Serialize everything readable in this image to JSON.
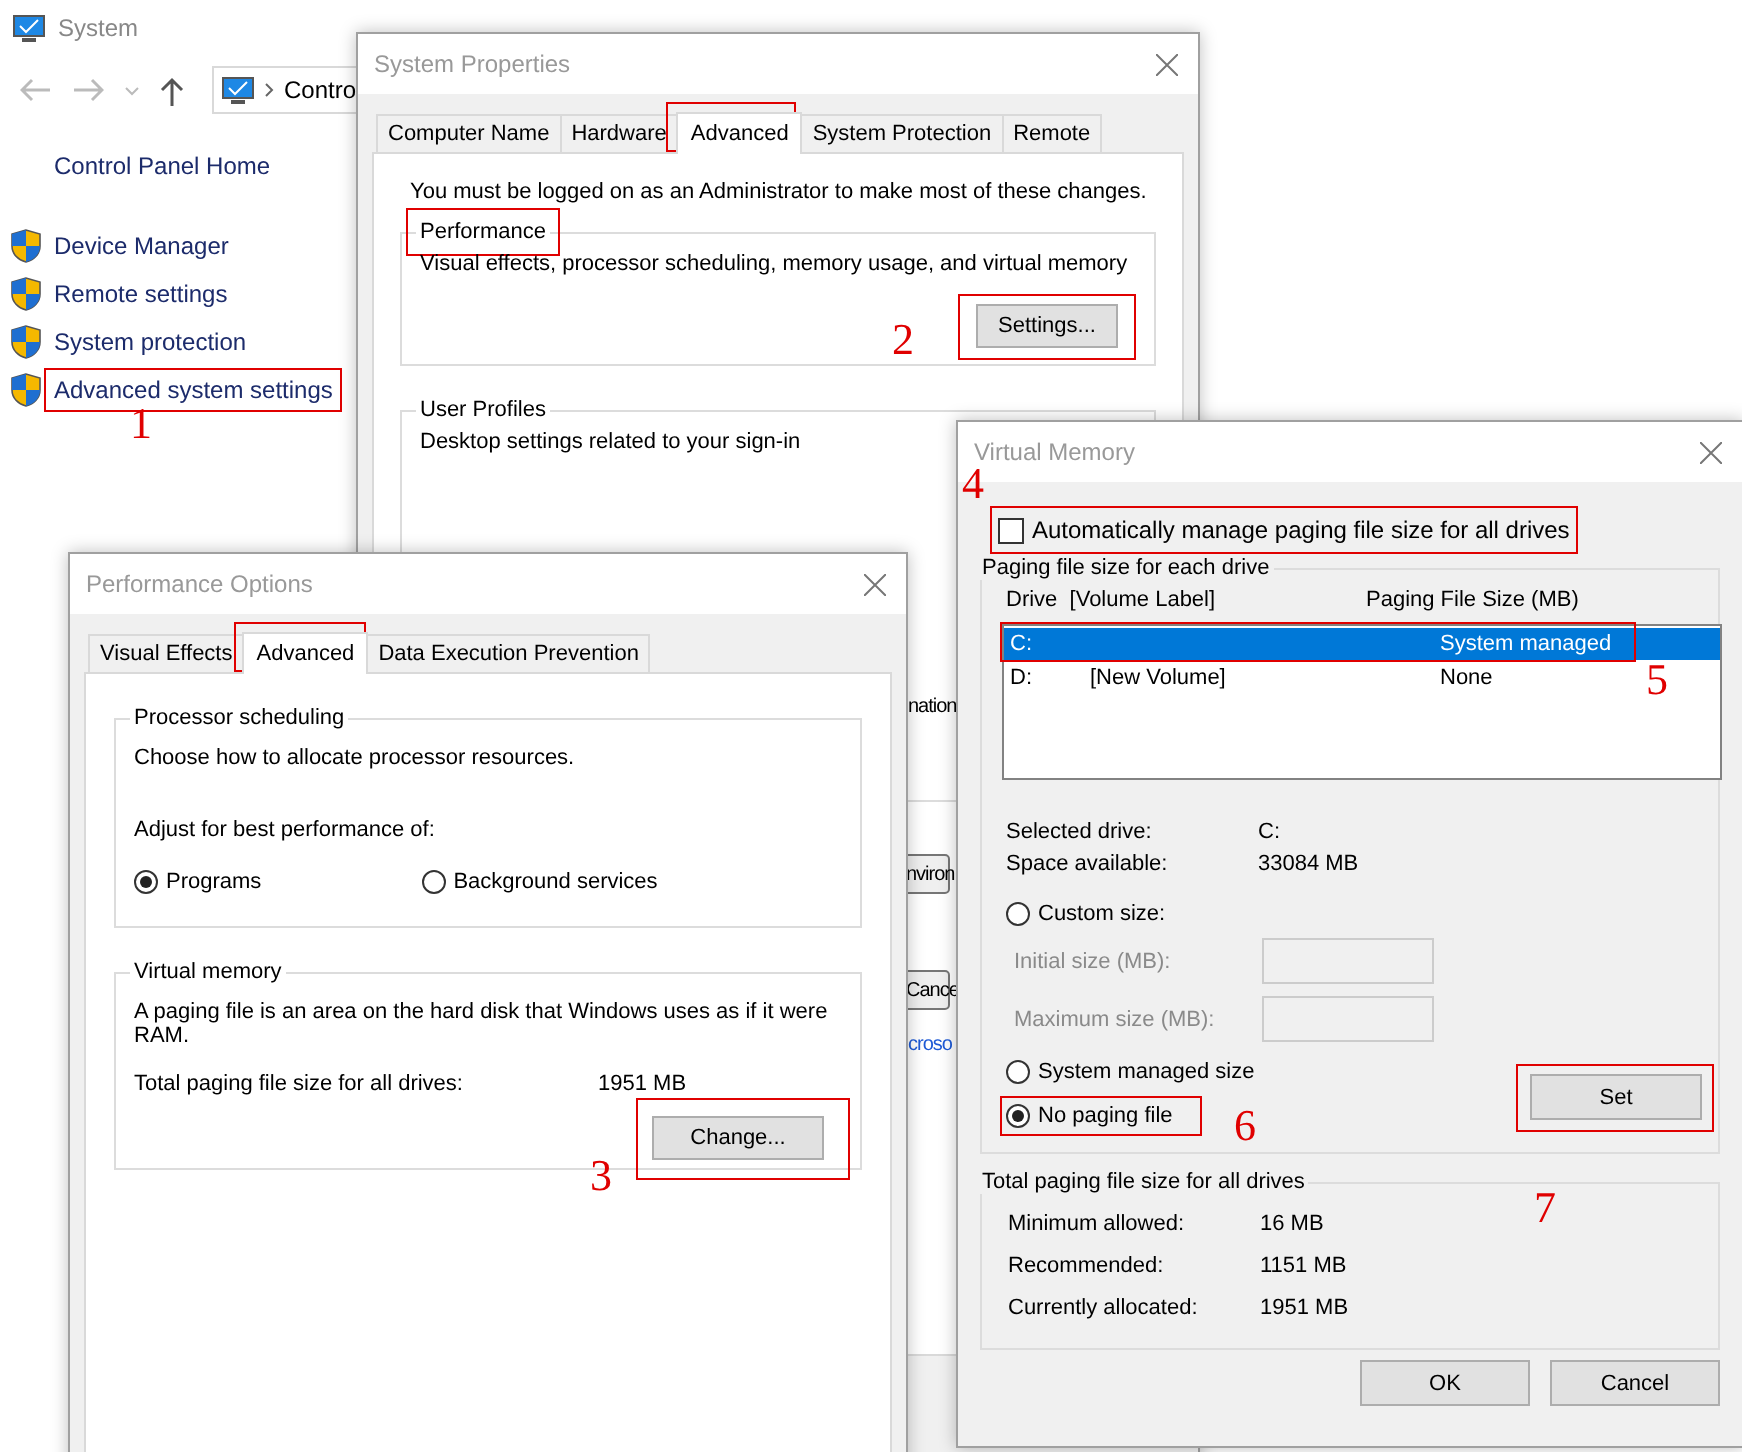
{
  "system_window": {
    "title": "System",
    "address": "Contro",
    "home_link": "Control Panel Home",
    "tasks": [
      "Device Manager",
      "Remote settings",
      "System protection",
      "Advanced system settings"
    ]
  },
  "system_properties": {
    "title": "System Properties",
    "tabs": [
      {
        "label": "Computer Name",
        "selected": false
      },
      {
        "label": "Hardware",
        "selected": false
      },
      {
        "label": "Advanced",
        "selected": true
      },
      {
        "label": "System Protection",
        "selected": false
      },
      {
        "label": "Remote",
        "selected": false
      }
    ],
    "admin_note": "You must be logged on as an Administrator to make most of these changes.",
    "performance": {
      "legend": "Performance",
      "description": "Visual effects, processor scheduling, memory usage, and virtual memory",
      "button": "Settings..."
    },
    "user_profiles": {
      "legend": "User Profiles",
      "description": "Desktop settings related to your sign-in"
    },
    "partial_text": "nation",
    "partial_buttons": [
      "nviron",
      "Cance"
    ],
    "partial_link": "croso"
  },
  "performance_options": {
    "title": "Performance Options",
    "tabs": [
      {
        "label": "Visual Effects",
        "selected": false
      },
      {
        "label": "Advanced",
        "selected": true
      },
      {
        "label": "Data Execution Prevention",
        "selected": false
      }
    ],
    "processor_scheduling": {
      "legend": "Processor scheduling",
      "description": "Choose how to allocate processor resources.",
      "prompt": "Adjust for best performance of:",
      "options": [
        {
          "label": "Programs",
          "selected": true
        },
        {
          "label": "Background services",
          "selected": false
        }
      ]
    },
    "virtual_memory": {
      "legend": "Virtual memory",
      "description": "A paging file is an area on the hard disk that Windows uses as if it were RAM.",
      "total_label": "Total paging file size for all drives:",
      "total_value": "1951 MB",
      "button": "Change..."
    }
  },
  "virtual_memory": {
    "title": "Virtual Memory",
    "auto_manage": {
      "label": "Automatically manage paging file size for all drives",
      "checked": false
    },
    "drives_legend": "Paging file size for each drive",
    "columns": [
      "Drive  [Volume Label]",
      "Paging File Size (MB)"
    ],
    "drives": [
      {
        "drive": "C:",
        "size": "System managed",
        "selected": true
      },
      {
        "drive": "D:",
        "label": "[New Volume]",
        "size": "None",
        "selected": false
      }
    ],
    "info": [
      {
        "label": "Selected drive:",
        "value": "C:"
      },
      {
        "label": "Space available:",
        "value": "33084 MB"
      }
    ],
    "size_options": [
      {
        "label": "Custom size:",
        "selected": false
      },
      {
        "label": "System managed size",
        "selected": false
      },
      {
        "label": "No paging file",
        "selected": true
      }
    ],
    "size_fields": [
      {
        "label": "Initial size (MB):",
        "disabled": true
      },
      {
        "label": "Maximum size (MB):",
        "disabled": true
      }
    ],
    "set_button": "Set",
    "totals_legend": "Total paging file size for all drives",
    "totals": [
      {
        "label": "Minimum allowed:",
        "value": "16 MB"
      },
      {
        "label": "Recommended:",
        "value": "1151 MB"
      },
      {
        "label": "Currently allocated:",
        "value": "1951 MB"
      }
    ],
    "buttons": [
      "OK",
      "Cancel"
    ]
  },
  "steps": [
    "1",
    "2",
    "3",
    "4",
    "5",
    "6",
    "7"
  ]
}
